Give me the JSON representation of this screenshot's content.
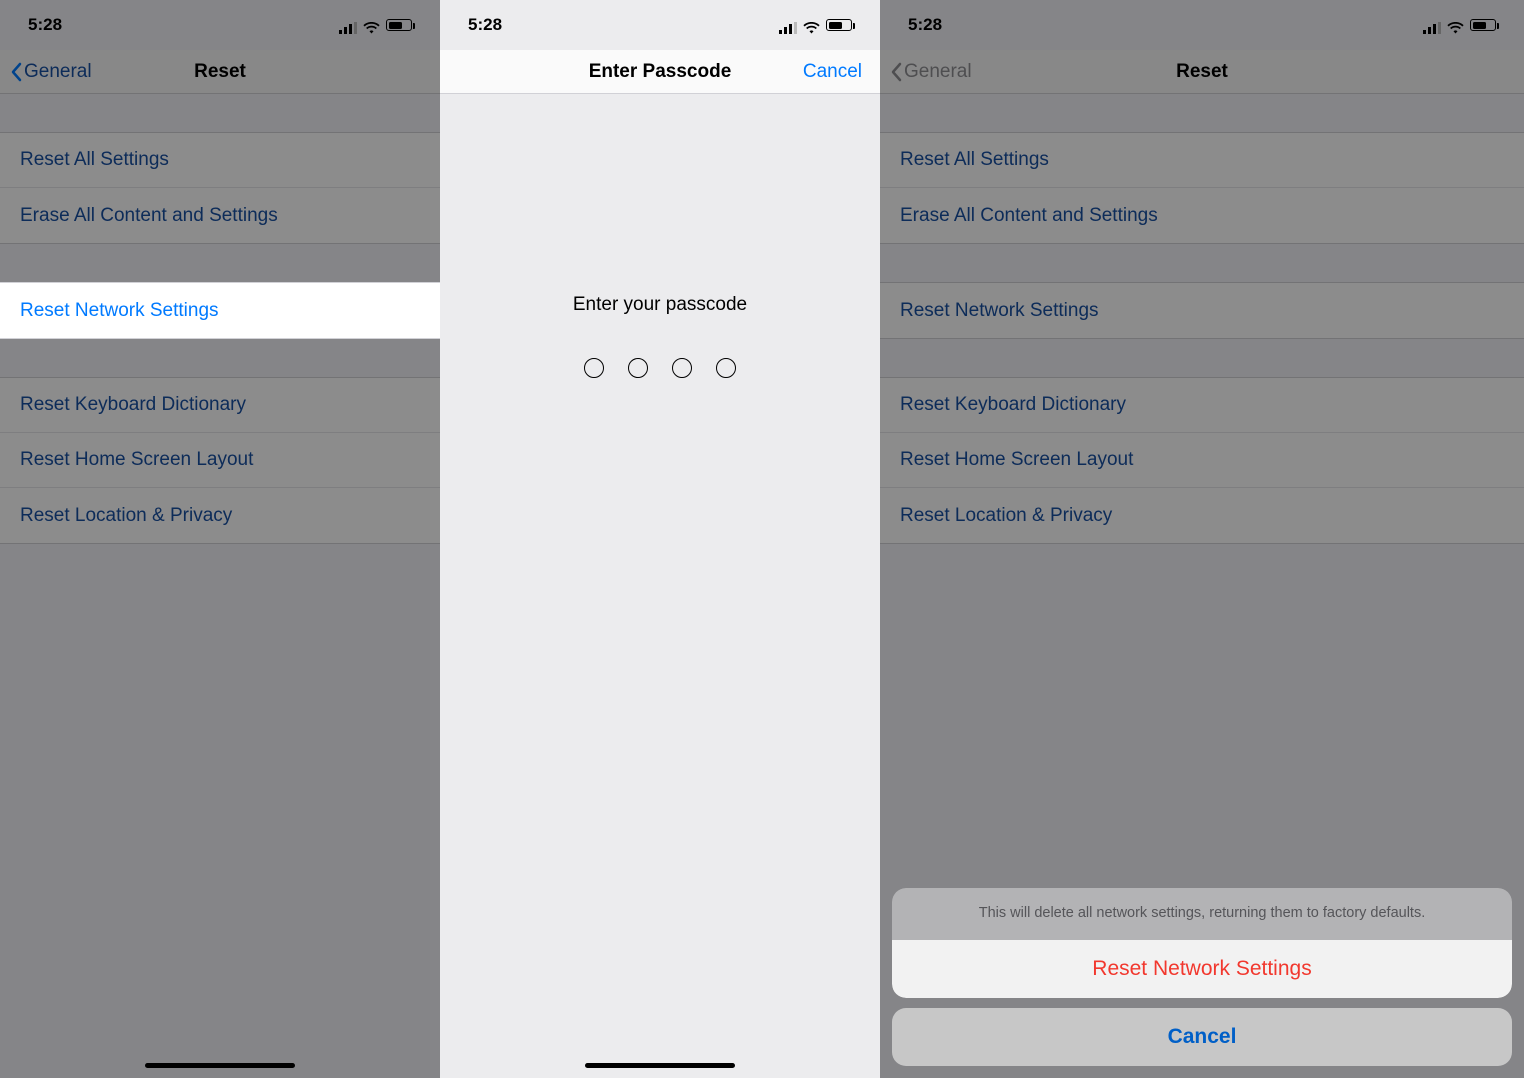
{
  "status": {
    "time": "5:28"
  },
  "reset": {
    "back_label": "General",
    "title": "Reset",
    "items_a": [
      "Reset All Settings",
      "Erase All Content and Settings"
    ],
    "items_b": [
      "Reset Network Settings"
    ],
    "items_c": [
      "Reset Keyboard Dictionary",
      "Reset Home Screen Layout",
      "Reset Location & Privacy"
    ]
  },
  "passcode": {
    "title": "Enter Passcode",
    "cancel": "Cancel",
    "prompt": "Enter your passcode"
  },
  "sheet": {
    "message": "This will delete all network settings, returning them to factory defaults.",
    "confirm": "Reset Network Settings",
    "cancel": "Cancel"
  }
}
